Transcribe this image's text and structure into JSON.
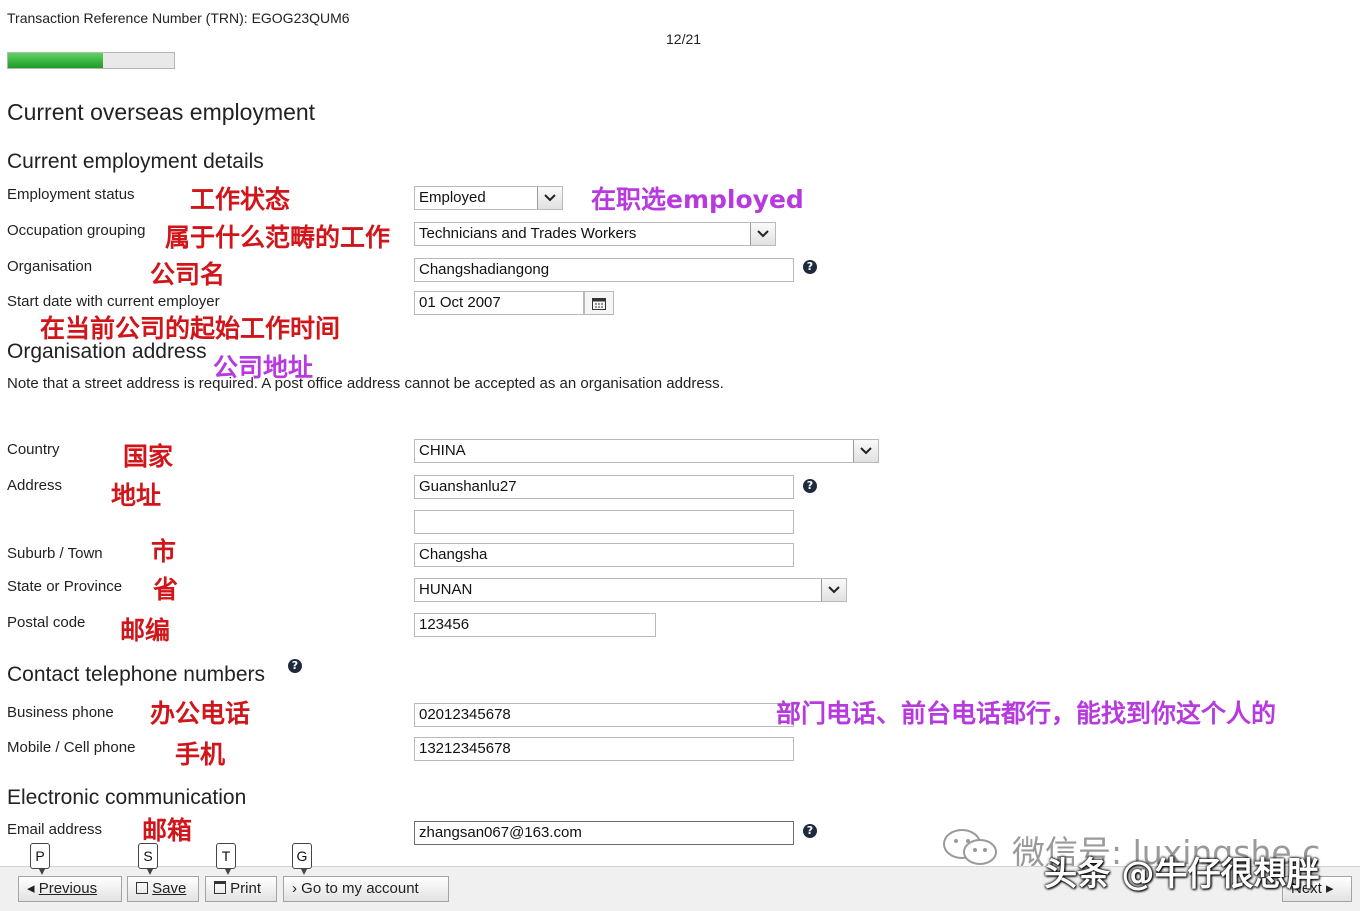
{
  "header": {
    "trn_label": "Transaction Reference Number (TRN):",
    "trn_value": "EGOG23QUM6",
    "page_progress": "12/21",
    "progress_fraction": 0.571
  },
  "page_title": "Current overseas employment",
  "details": {
    "heading": "Current employment details",
    "employment_status": {
      "label": "Employment status",
      "value": "Employed",
      "annotation": "工作状态",
      "note": "在职选employed"
    },
    "occupation": {
      "label": "Occupation grouping",
      "value": "Technicians and Trades Workers",
      "annotation": "属于什么范畴的工作"
    },
    "organisation": {
      "label": "Organisation",
      "value": "Changshadiangong",
      "annotation": "公司名"
    },
    "start_date": {
      "label": "Start date with current employer",
      "value": "01 Oct 2007",
      "annotation": "在当前公司的起始工作时间"
    }
  },
  "address": {
    "heading": "Organisation address",
    "heading_annotation": "公司地址",
    "note": "Note that a street address is required. A post office address cannot be accepted as an organisation address.",
    "country": {
      "label": "Country",
      "value": "CHINA",
      "annotation": "国家"
    },
    "address": {
      "label": "Address",
      "line1": "Guanshanlu27",
      "line2": "",
      "annotation": "地址"
    },
    "suburb": {
      "label": "Suburb / Town",
      "value": "Changsha",
      "annotation": "市"
    },
    "state": {
      "label": "State or Province",
      "value": "HUNAN",
      "annotation": "省"
    },
    "postal": {
      "label": "Postal code",
      "value": "123456",
      "annotation": "邮编"
    }
  },
  "phones": {
    "heading": "Contact telephone numbers",
    "business": {
      "label": "Business phone",
      "value": "02012345678",
      "annotation": "办公电话",
      "note": "部门电话、前台电话都行，能找到你这个人的"
    },
    "mobile": {
      "label": "Mobile / Cell phone",
      "value": "13212345678",
      "annotation": "手机"
    }
  },
  "electronic": {
    "heading": "Electronic communication",
    "email": {
      "label": "Email address",
      "value": "zhangsan067@163.com",
      "annotation": "邮箱"
    }
  },
  "footer": {
    "keys": [
      "P",
      "S",
      "T",
      "G"
    ],
    "previous": "Previous",
    "save": "Save",
    "print": "Print",
    "account": "Go to my account",
    "next": "Next"
  },
  "watermark": {
    "wechat": "微信号: luxingshe.c",
    "toutiao": "头条 @牛仔很想胖"
  },
  "colors": {
    "progress": "#2fb335",
    "annotation_red": "#d0161a",
    "annotation_purple": "#b73adf"
  }
}
